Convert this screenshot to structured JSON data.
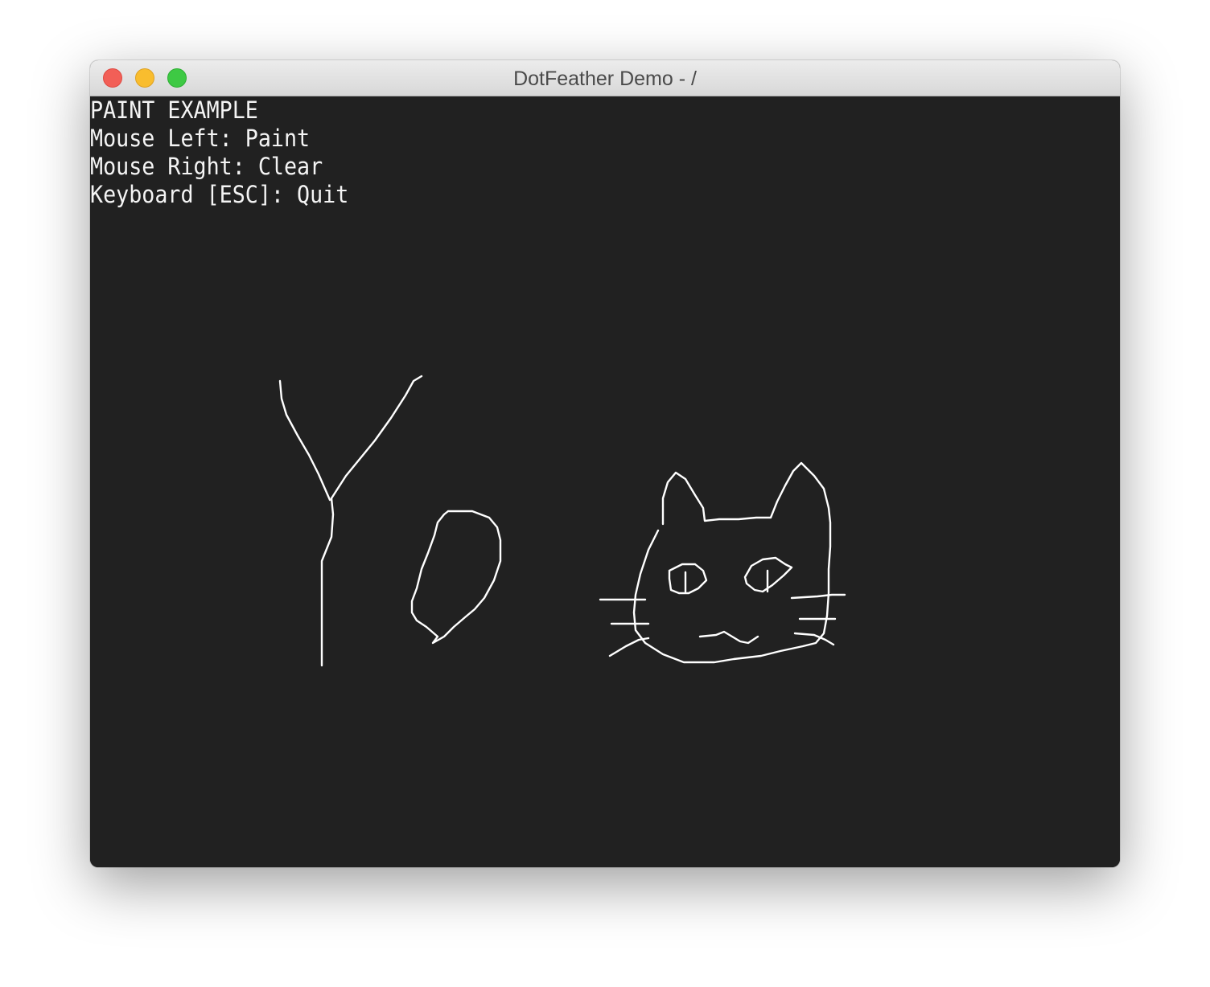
{
  "window": {
    "title": "DotFeather Demo - /"
  },
  "help": {
    "lines": [
      "PAINT EXAMPLE",
      "Mouse Left: Paint",
      "Mouse Right: Clear",
      "Keyboard [ESC]: Quit"
    ]
  },
  "colors": {
    "canvas_background": "#212121",
    "paint_stroke": "#ffffff",
    "text": "#f4f4f4"
  }
}
